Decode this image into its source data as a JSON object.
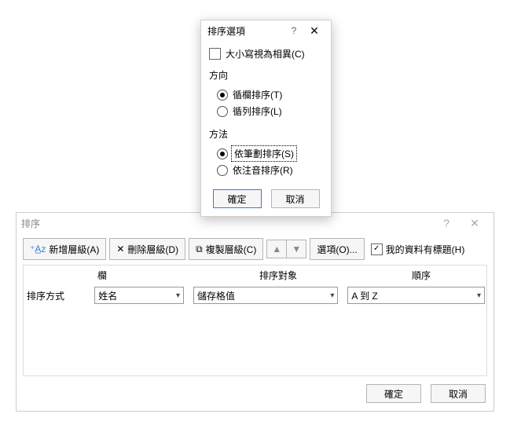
{
  "sort": {
    "title": "排序",
    "toolbar": {
      "add": "新增層級(A)",
      "del": "刪除層級(D)",
      "copy": "複製層級(C)",
      "opts": "選項(O)...",
      "header_label": "我的資料有標題(H)",
      "header_checked": true
    },
    "grid": {
      "col1": "欄",
      "col2": "排序對象",
      "col3": "順序",
      "row_label": "排序方式",
      "sel_a": "姓名",
      "sel_b": "儲存格值",
      "sel_c": "A 到 Z"
    },
    "ok": "確定",
    "cancel": "取消"
  },
  "opts": {
    "title": "排序選項",
    "case": "大小寫視為相異(C)",
    "dir_label": "方向",
    "dir_col": "循欄排序(T)",
    "dir_row": "循列排序(L)",
    "meth_label": "方法",
    "meth_stroke": "依筆劃排序(S)",
    "meth_zhuyin": "依注音排序(R)",
    "ok": "確定",
    "cancel": "取消"
  }
}
